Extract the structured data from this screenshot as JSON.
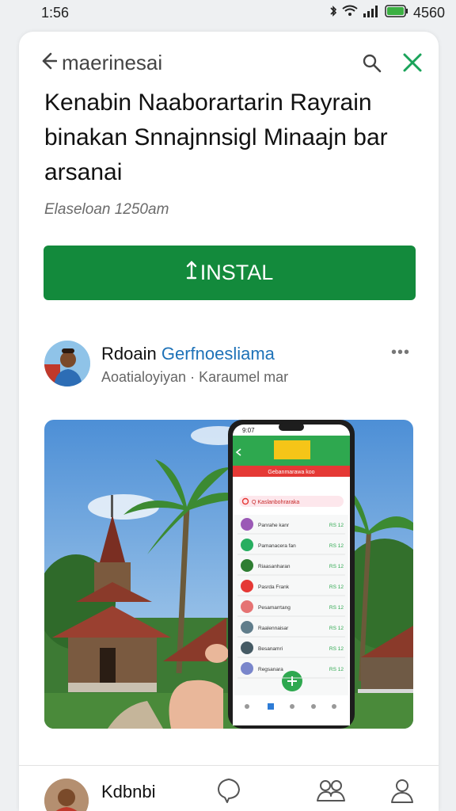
{
  "status": {
    "time": "1:56",
    "battery": "4560"
  },
  "topbar": {
    "back_label": "maerinesai"
  },
  "app": {
    "title": "Kenabin Naaborartarin Rayrain binakan Snnajnnsigl Minaajn bar arsanai",
    "meta": "Elaseloan 1250am",
    "install_label": "INSTAL"
  },
  "author": {
    "name_plain": "Rdoain",
    "name_link": "Gerfnoesliama",
    "subtitle": "Aoatialoyiyan · Karaumel mar",
    "more": "•••"
  },
  "phone": {
    "time": "9:07",
    "banner": "Gebanmarawa koo",
    "search": "Q Kaslanbohraraka",
    "rows": [
      {
        "label": "Panrahe kanr",
        "value": "RS 12",
        "color": "#9b59b6"
      },
      {
        "label": "Pamanacera fan",
        "value": "RS 12",
        "color": "#27ae60"
      },
      {
        "label": "Riaasanharan",
        "value": "RS 12",
        "color": "#2e7d32"
      },
      {
        "label": "Pasrda Frank",
        "value": "RS 12",
        "color": "#e53935"
      },
      {
        "label": "Pesamarrtang",
        "value": "RS 12",
        "color": "#e57373"
      },
      {
        "label": "Raalennaisar",
        "value": "RS 12",
        "color": "#607d8b"
      },
      {
        "label": "Besanamri",
        "value": "RS 12",
        "color": "#455a64"
      },
      {
        "label": "Regsanara",
        "value": "RS 12",
        "color": "#7986cb"
      }
    ]
  },
  "bottom": {
    "name": "Kdbnbi"
  },
  "colors": {
    "install": "#138a3c",
    "accent": "#1e72b8",
    "close": "#1aa35a"
  }
}
